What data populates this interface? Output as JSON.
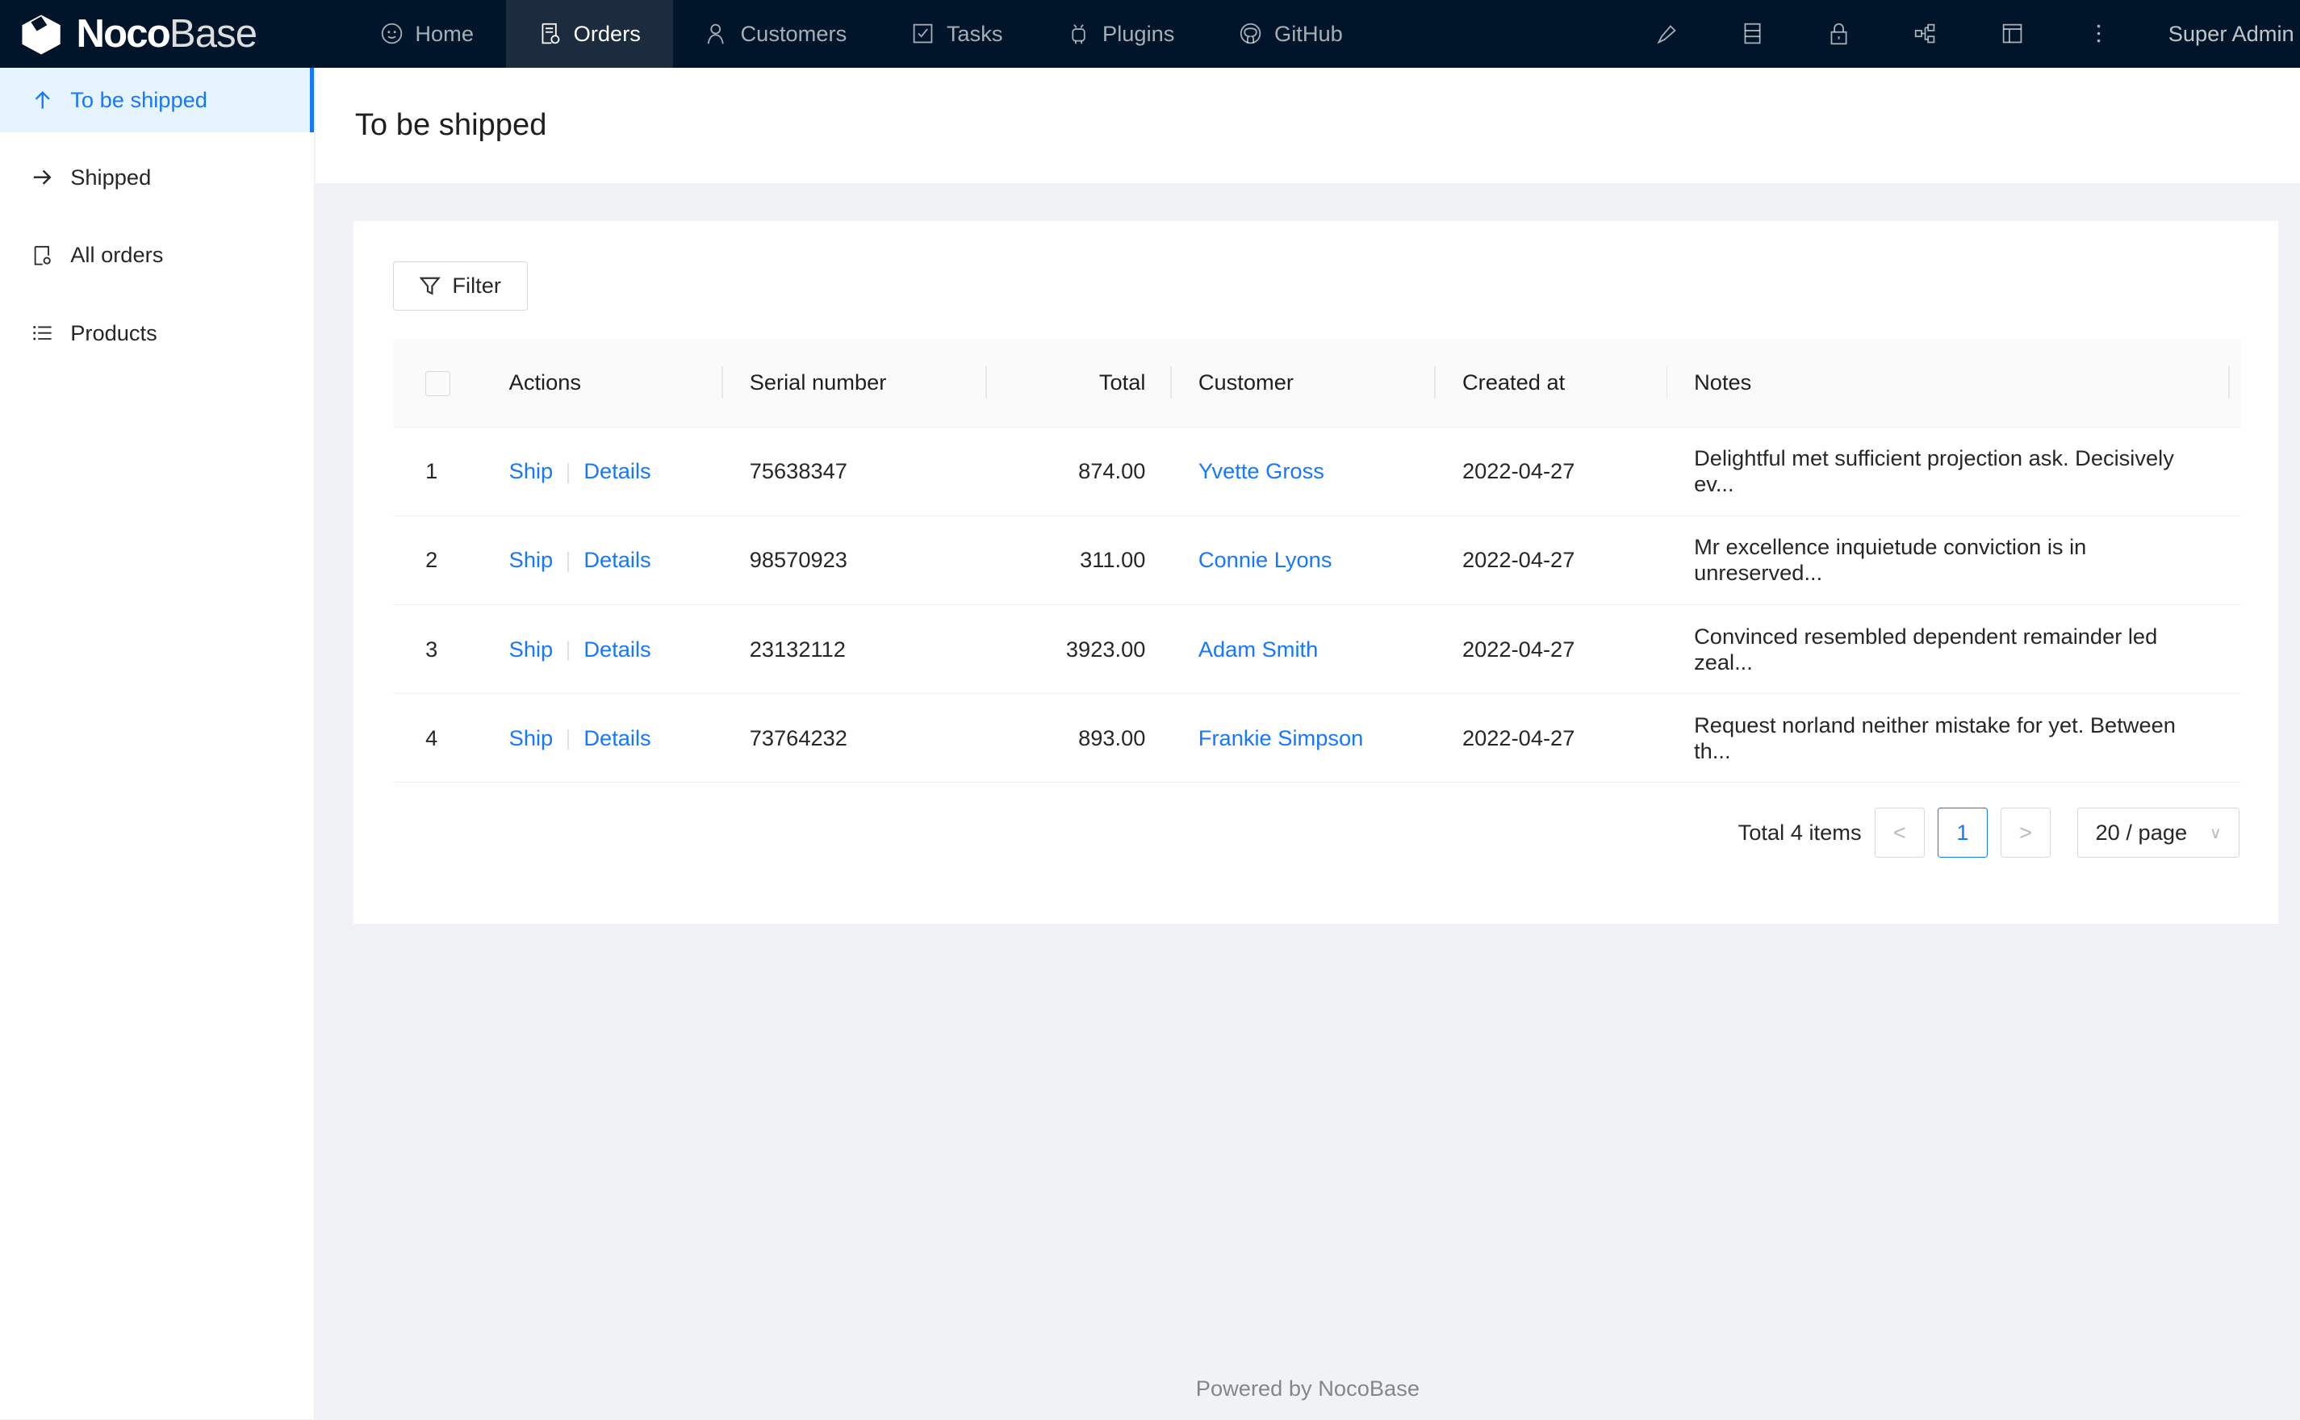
{
  "brand": {
    "bold": "Noco",
    "light": "Base"
  },
  "nav": [
    {
      "label": "Home",
      "icon": "smile-icon"
    },
    {
      "label": "Orders",
      "icon": "file-check-icon",
      "active": true
    },
    {
      "label": "Customers",
      "icon": "user-icon"
    },
    {
      "label": "Tasks",
      "icon": "check-square-icon"
    },
    {
      "label": "Plugins",
      "icon": "android-icon"
    },
    {
      "label": "GitHub",
      "icon": "github-icon"
    }
  ],
  "tools": [
    "highlight-icon",
    "database-icon",
    "lock-icon",
    "partition-icon",
    "layout-icon",
    "more-icon"
  ],
  "user": "Super Admin",
  "sidebar": [
    {
      "label": "To be shipped",
      "icon": "arrow-up-icon",
      "active": true
    },
    {
      "label": "Shipped",
      "icon": "arrow-right-icon"
    },
    {
      "label": "All orders",
      "icon": "file-search-icon"
    },
    {
      "label": "Products",
      "icon": "list-icon"
    }
  ],
  "page_title": "To be shipped",
  "filter_label": "Filter",
  "columns": [
    "Actions",
    "Serial number",
    "Total",
    "Customer",
    "Created at",
    "Notes"
  ],
  "row_actions": {
    "ship": "Ship",
    "details": "Details"
  },
  "rows": [
    {
      "index": "1",
      "serial": "75638347",
      "total": "874.00",
      "customer": "Yvette Gross",
      "created": "2022-04-27",
      "notes": "Delightful met sufficient projection ask. Decisively ev..."
    },
    {
      "index": "2",
      "serial": "98570923",
      "total": "311.00",
      "customer": "Connie Lyons",
      "created": "2022-04-27",
      "notes": "Mr excellence inquietude conviction is in unreserved..."
    },
    {
      "index": "3",
      "serial": "23132112",
      "total": "3923.00",
      "customer": "Adam Smith",
      "created": "2022-04-27",
      "notes": "Convinced resembled dependent remainder led zeal..."
    },
    {
      "index": "4",
      "serial": "73764232",
      "total": "893.00",
      "customer": "Frankie Simpson",
      "created": "2022-04-27",
      "notes": "Request norland neither mistake for yet. Between th..."
    }
  ],
  "pagination": {
    "total": "Total 4 items",
    "current": "1",
    "page_size": "20 / page"
  },
  "footer": "Powered by NocoBase",
  "colors": {
    "header": "#001529",
    "accent": "#1677ff"
  }
}
